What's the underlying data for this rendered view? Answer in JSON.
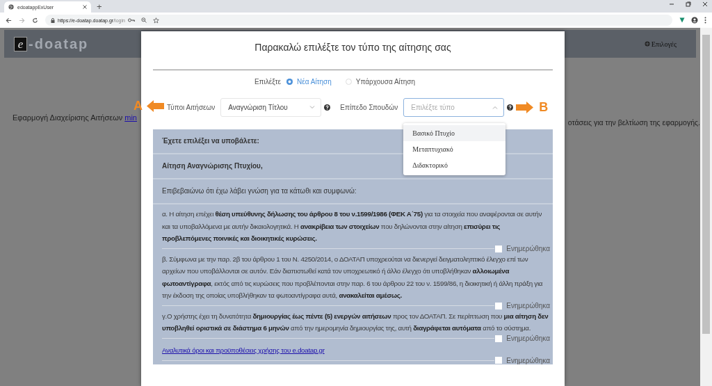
{
  "browser": {
    "tab_title": "edoatappExUser",
    "new_tab": "+",
    "url_host": "https://e-doatap.doatap.gr",
    "url_path": "/login"
  },
  "header": {
    "logo_letter": "e",
    "logo_text": "-doatap",
    "menu_label": "Επιλογές"
  },
  "background": {
    "left_text": "Εφαρμογή Διαχείρισης Αιτήσεων",
    "left_link": "min",
    "right_text": "οτάσεις για την βελτίωση της εφαρμογής."
  },
  "modal": {
    "title": "Παρακαλώ επιλέξτε τον τύπο της αίτησης σας",
    "choose_label": "Επιλέξτε",
    "modes": [
      {
        "label": "Νέα Αίτηση",
        "selected": true
      },
      {
        "label": "Υπάρχουσα Αίτηση",
        "selected": false
      }
    ],
    "fields": [
      {
        "label": "Τύποι Αιτήσεων",
        "value": "Αναγνώριση Τίτλου",
        "expanded": false,
        "annotation": {
          "letter": "A",
          "kind": "leftward"
        }
      },
      {
        "label": "Επίπεδο Σπουδών",
        "placeholder": "Επιλέξτε τύπο",
        "expanded": true,
        "annotation": {
          "letter": "B",
          "kind": "rightward"
        },
        "options": [
          {
            "label": "Βασικό Πτυχίο",
            "selected": true
          },
          {
            "label": "Μεταπτυχιακό",
            "selected": false
          },
          {
            "label": "Διδακτορικό",
            "selected": false
          }
        ]
      }
    ],
    "summary": {
      "heading": "Έχετε επιλέξει να υποβάλετε:",
      "application": "Αίτηση Αναγνώρισης Πτυχίου,",
      "intro": "Επιβεβαιώνω ότι έχω λάβει γνώση για τα κάτωθι και συμφωνώ:"
    },
    "terms": [
      {
        "kind": "text",
        "text": "α. Η αίτηση επέχει **θέση υπεύθυνης δήλωσης του άρθρου 8 του ν.1599/1986 (ΦΕΚ Α΄75)** για τα στοιχεία που αναφέρονται σε αυτήν και τα υποβαλλόμενα με αυτήν δικαιολογητικά. Η **ανακρίβεια των στοιχείων** που δηλώνονται στην αίτηση **επισύρει τις προβλεπόμενες ποινικές και διοικητικές κυρώσεις.**",
        "checked": false,
        "checkbox_label": "Ενημερώθηκα"
      },
      {
        "kind": "text",
        "text": "β. Σύμφωνα με την παρ. 2β του άρθρου 1 του Ν. 4250/2014, ο ΔΟΑΤΑΠ υποχρεούται να διενεργεί δειγματοληπτικό έλεγχο επί των αρχείων που υποβάλλονται σε αυτόν. Εάν διαπιστωθεί κατά τον υποχρεωτικό ή άλλο έλεγχο ότι υποβλήθηκαν **αλλοιωμένα φωτοαντίγραφα**, εκτός από τις κυρώσεις που προβλέπονται στην παρ. 6 του άρθρου 22 του ν. 1599/86, η διοικητική ή άλλη πράξη για την έκδοση της οποίας υποβλήθηκαν τα φωτοαντίγραφα αυτά, **ανακαλείται αμέσως.**",
        "checked": false,
        "checkbox_label": "Ενημερώθηκα"
      },
      {
        "kind": "text",
        "text": "γ.Ο χρήστης έχει τη δυνατότητα **δημιουργίας έως πέντε (5) ενεργών αιτήσεων** προς τον ΔΟΑΤΑΠ. Σε περίπτωση που **μια αίτηση δεν υποβληθεί οριστικά σε διάστημα 6 μηνών** από την ημερομηνία δημιουργίας της, αυτή **διαγράφεται αυτόματα** από το σύστημα.",
        "checked": false,
        "checkbox_label": "Ενημερώθηκα"
      },
      {
        "kind": "link",
        "text": "Αναλυτικά όροι και προϋποθέσεις χρήσης του e.doatap.gr",
        "checked": false,
        "checkbox_label": "Ενημερώθηκα"
      }
    ]
  }
}
